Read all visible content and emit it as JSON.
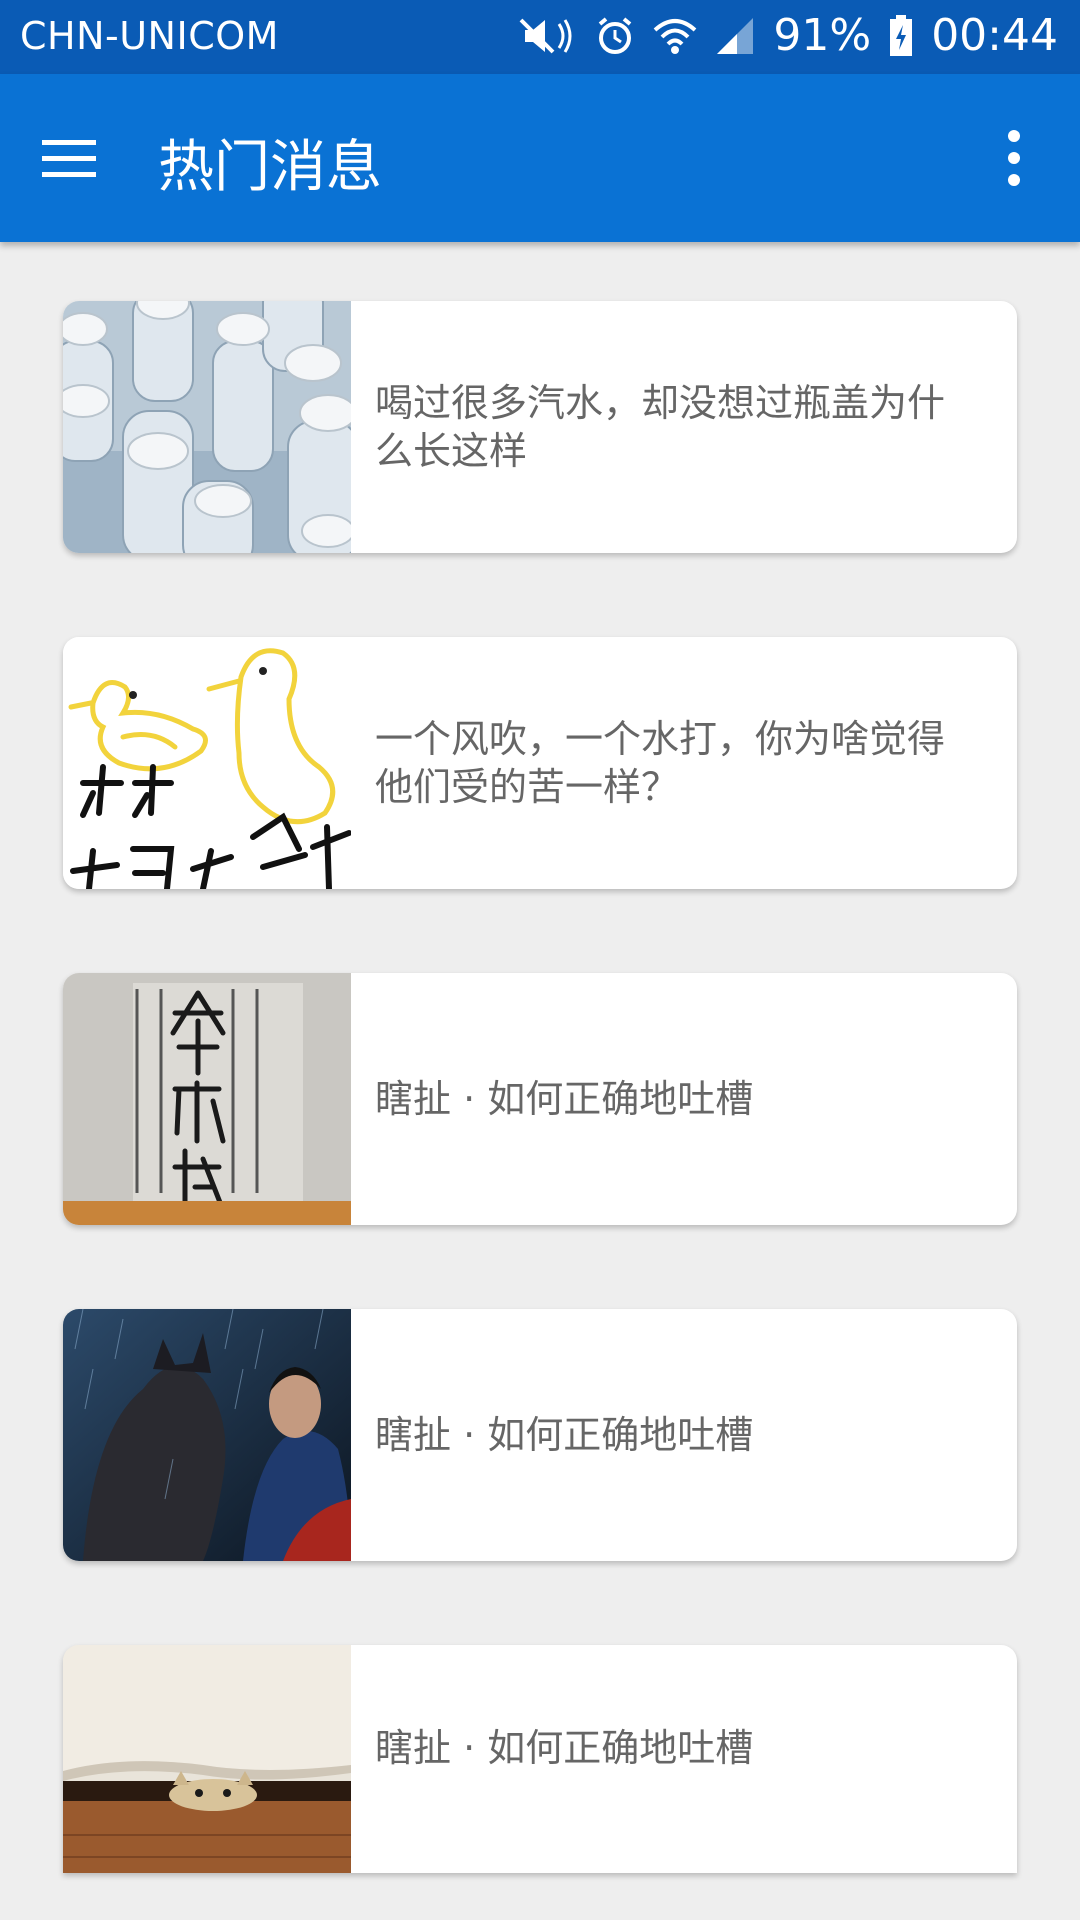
{
  "status_bar": {
    "carrier": "CHN-UNICOM",
    "battery": "91%",
    "time": "00:44",
    "icons": [
      "mute-icon",
      "alarm-icon",
      "wifi-icon",
      "signal-icon",
      "battery-charging-icon"
    ]
  },
  "app_bar": {
    "title": "热门消息",
    "menu_icon": "hamburger-menu-icon",
    "overflow_icon": "more-vert-icon"
  },
  "news_items": [
    {
      "title": "喝过很多汽水，却没想过瓶盖为什么长这样",
      "image": "water-bottles-image"
    },
    {
      "title": "一个风吹，一个水打，你为啥觉得他们受的苦一样？",
      "image": "duck-drawing-image"
    },
    {
      "title": "瞎扯 · 如何正确地吐槽",
      "image": "book-cover-image"
    },
    {
      "title": "瞎扯 · 如何正确地吐槽",
      "image": "movie-still-image"
    },
    {
      "title": "瞎扯 · 如何正确地吐槽",
      "image": "cat-under-sofa-image"
    }
  ],
  "colors": {
    "status_bar": "#0a5bb5",
    "app_bar": "#0a72d4",
    "background": "#eeeeee",
    "card_text": "#666666"
  }
}
